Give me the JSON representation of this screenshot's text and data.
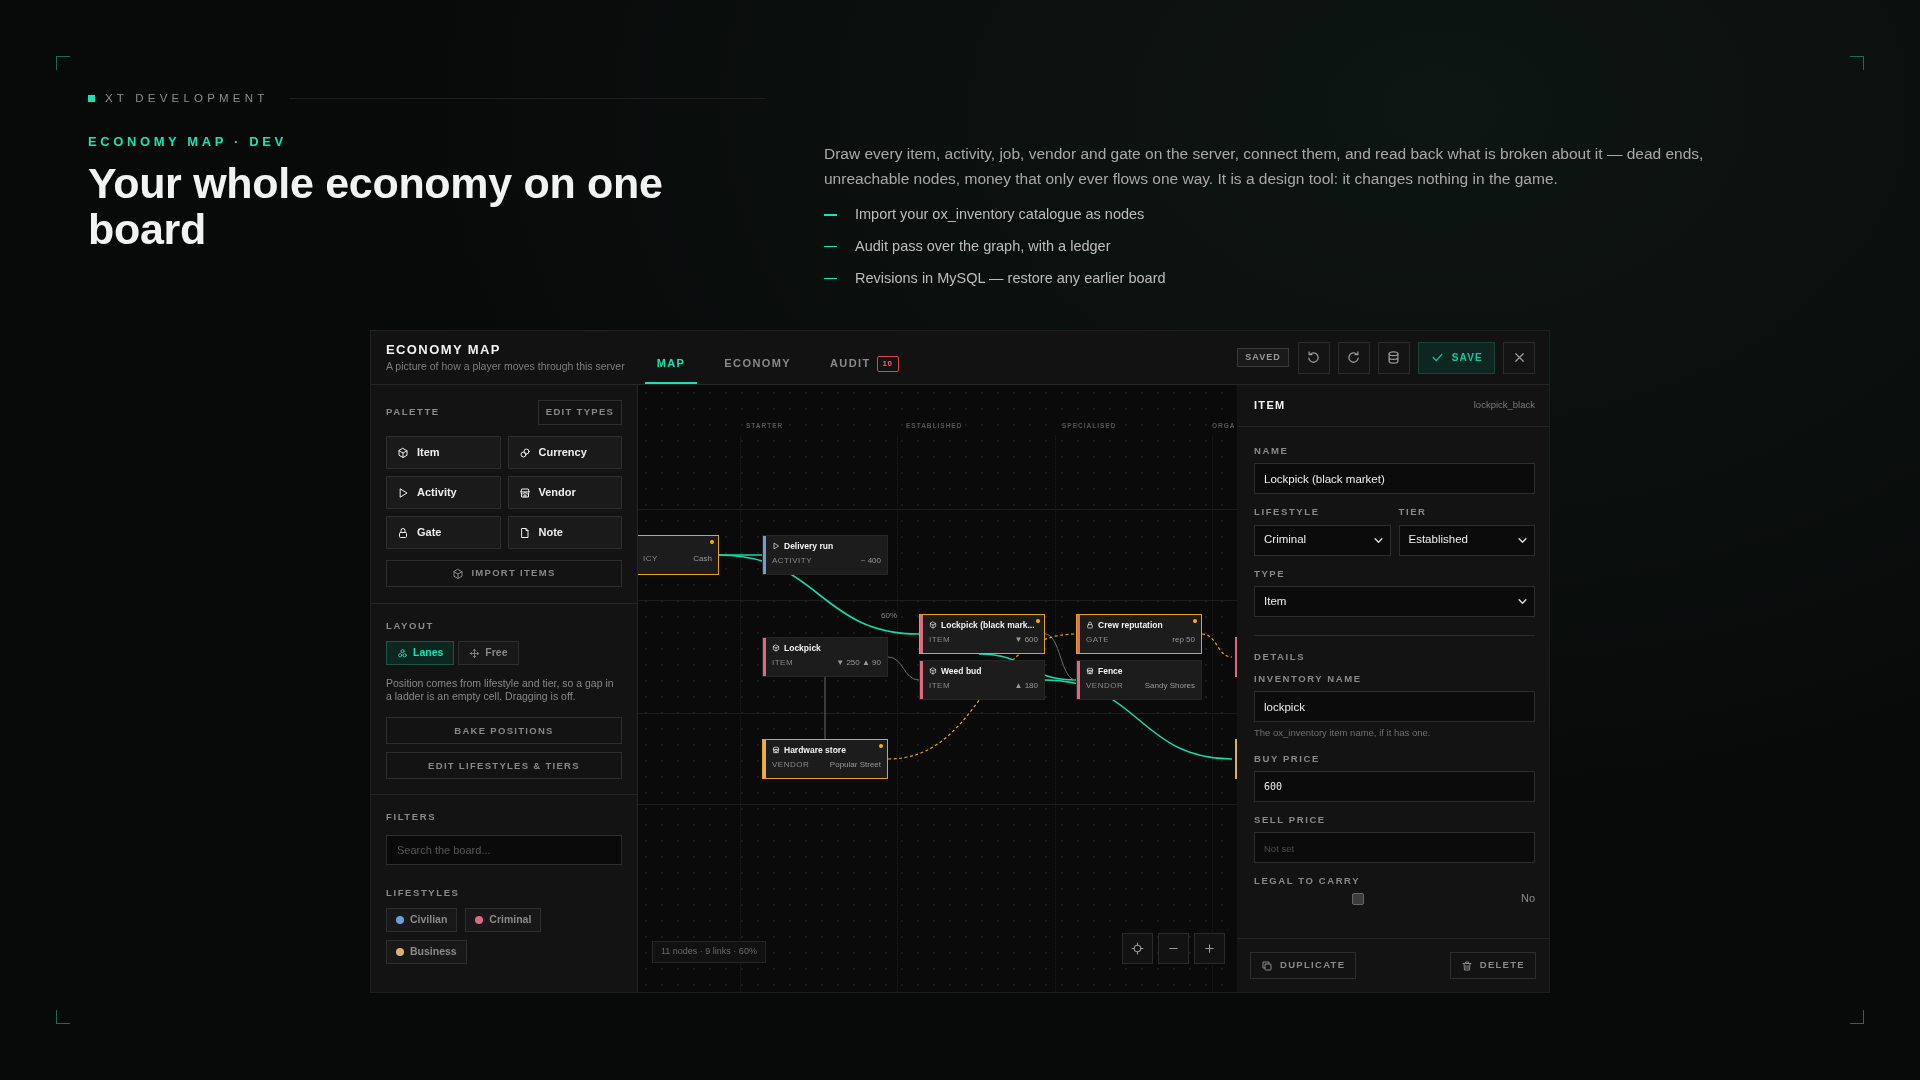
{
  "brand": {
    "label": "XT DEVELOPMENT"
  },
  "hero": {
    "eyebrow": "ECONOMY MAP · DEV",
    "title": "Your whole economy on one board",
    "description": "Draw every item, activity, job, vendor and gate on the server, connect them, and read back what is broken about it — dead ends, unreachable nodes, money that only ever flows one way. It is a design tool: it changes nothing in the game.",
    "bullets": [
      "Import your ox_inventory catalogue as nodes",
      "Audit pass over the graph, with a ledger",
      "Revisions in MySQL — restore any earlier board"
    ]
  },
  "app": {
    "title": "ECONOMY MAP",
    "subtitle": "A picture of how a player moves through this server",
    "tabs": [
      {
        "label": "MAP",
        "selected": true
      },
      {
        "label": "ECONOMY",
        "selected": false
      },
      {
        "label": "AUDIT",
        "selected": false,
        "badge": "10"
      }
    ],
    "status": "SAVED",
    "tools": [
      {
        "kind": "undo"
      },
      {
        "kind": "redo"
      },
      {
        "kind": "database"
      },
      {
        "kind": "save",
        "label": "SAVE"
      },
      {
        "kind": "close"
      }
    ]
  },
  "palette": {
    "title": "PALETTE",
    "edit_label": "EDIT TYPES",
    "items": [
      {
        "label": "Item",
        "kind": "item"
      },
      {
        "label": "Currency",
        "kind": "currency"
      },
      {
        "label": "Activity",
        "kind": "activity"
      },
      {
        "label": "Vendor",
        "kind": "vendor"
      },
      {
        "label": "Gate",
        "kind": "gate"
      },
      {
        "label": "Note",
        "kind": "note"
      }
    ],
    "import_label": "IMPORT ITEMS"
  },
  "layout": {
    "title": "LAYOUT",
    "modes": [
      {
        "label": "Lanes",
        "kind": "lanes",
        "selected": true
      },
      {
        "label": "Free",
        "kind": "free",
        "selected": false
      }
    ],
    "note": "Position comes from lifestyle and tier, so a gap in a ladder is an empty cell. Dragging is off.",
    "actions": [
      "BAKE POSITIONS",
      "EDIT LIFESTYLES & TIERS"
    ]
  },
  "filters": {
    "title": "FILTERS",
    "search_placeholder": "Search the board...",
    "lifestyles_title": "LIFESTYLES",
    "lifestyles": [
      {
        "label": "Civilian",
        "color": "#6a9fd8"
      },
      {
        "label": "Criminal",
        "color": "#dd6a7e"
      },
      {
        "label": "Business",
        "color": "#dcae6e"
      }
    ]
  },
  "canvas": {
    "lanes": [
      "STARTER",
      "ESTABLISHED",
      "SPECIALISED",
      "ORGA"
    ],
    "nodes": [
      {
        "category": "ICY",
        "meta": "Cash",
        "flagged": true
      },
      {
        "kind": "activity",
        "title": "Delivery run",
        "category": "ACTIVITY",
        "meta": "~ 400",
        "color": "#6a9fd8",
        "flagged": false
      },
      {
        "kind": "item",
        "title": "Lockpick (black mark...",
        "category": "ITEM",
        "meta": "▼ 600",
        "color": "#dd6a7e",
        "flagged": true
      },
      {
        "kind": "gate",
        "title": "Crew reputation",
        "category": "GATE",
        "meta": "rep 50",
        "color": "#dd6a7e",
        "flagged": true
      },
      {
        "kind": "item",
        "title": "Lockpick",
        "category": "ITEM",
        "meta": "▼ 250 ▲ 90",
        "color": "#dd6a7e",
        "flagged": false
      },
      {
        "kind": "item",
        "title": "Weed bud",
        "category": "ITEM",
        "meta": "▲ 180",
        "color": "#dd6a7e",
        "flagged": false
      },
      {
        "kind": "vendor",
        "title": "Fence",
        "category": "VENDOR",
        "meta": "Sandy Shores",
        "color": "#dd6a7e",
        "flagged": false
      },
      {
        "kind": "vendor",
        "title": "Hardware store",
        "category": "VENDOR",
        "meta": "Popular Street",
        "color": "#dcae6e",
        "flagged": true
      },
      {
        "color": "#dd6a7e",
        "flagged": false
      },
      {
        "color": "#dcae6e",
        "flagged": false
      }
    ],
    "edges": [
      {
        "kind": "money"
      },
      {
        "kind": "money",
        "label": "60%"
      },
      {
        "kind": "money"
      },
      {
        "kind": "money"
      },
      {
        "kind": "link"
      },
      {
        "kind": "link"
      },
      {
        "kind": "link"
      },
      {
        "kind": "unlock"
      },
      {
        "kind": "unlock"
      }
    ],
    "stats": "11 nodes · 9 links · 60%",
    "controls": [
      {
        "kind": "recenter"
      },
      {
        "kind": "zoom-out"
      },
      {
        "kind": "zoom-in"
      }
    ]
  },
  "inspector": {
    "title": "ITEM",
    "ref": "lockpick_black",
    "name": {
      "label": "NAME",
      "value": "Lockpick (black market)"
    },
    "lifestyle": {
      "label": "LIFESTYLE",
      "value": "Criminal"
    },
    "tier": {
      "label": "TIER",
      "value": "Established"
    },
    "type": {
      "label": "TYPE",
      "value": "Item"
    },
    "details_title": "DETAILS",
    "inventory_name": {
      "label": "INVENTORY NAME",
      "value": "lockpick",
      "hint": "The ox_inventory item name, if it has one."
    },
    "buy_price": {
      "label": "BUY PRICE",
      "value": "600"
    },
    "sell_price": {
      "label": "SELL PRICE",
      "placeholder": "Not set"
    },
    "legal": {
      "label": "LEGAL TO CARRY",
      "checked": false,
      "state_text": "No"
    },
    "actions": [
      {
        "label": "DUPLICATE",
        "kind": "duplicate"
      },
      {
        "label": "DELETE",
        "kind": "delete"
      }
    ]
  }
}
